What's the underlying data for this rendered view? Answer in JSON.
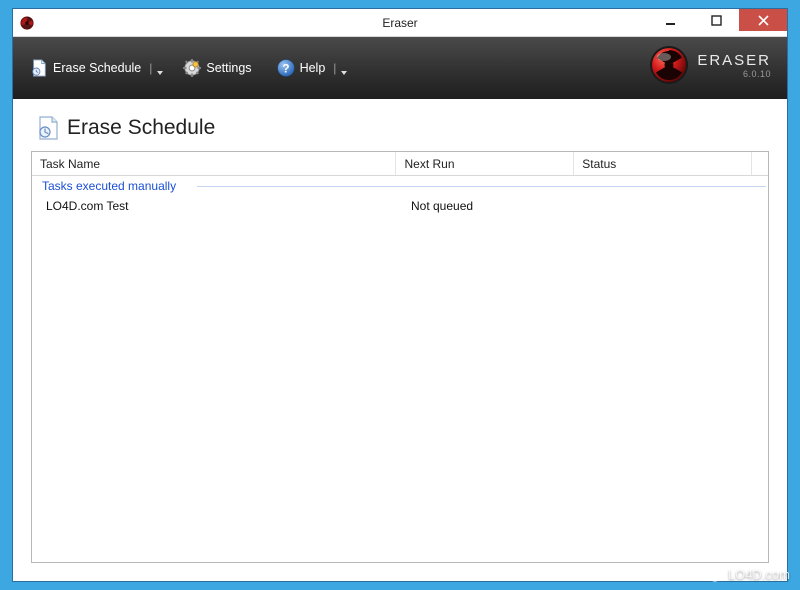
{
  "window": {
    "title": "Eraser"
  },
  "toolbar": {
    "erase_schedule_label": "Erase Schedule",
    "settings_label": "Settings",
    "help_label": "Help"
  },
  "brand": {
    "name": "ERASER",
    "version": "6.0.10"
  },
  "page": {
    "title": "Erase Schedule"
  },
  "columns": {
    "task_name": "Task Name",
    "next_run": "Next Run",
    "status": "Status"
  },
  "groups": [
    {
      "label": "Tasks executed manually",
      "rows": [
        {
          "task_name": "LO4D.com Test",
          "next_run": "Not queued",
          "status": ""
        }
      ]
    }
  ],
  "watermark": "LO4D.com"
}
